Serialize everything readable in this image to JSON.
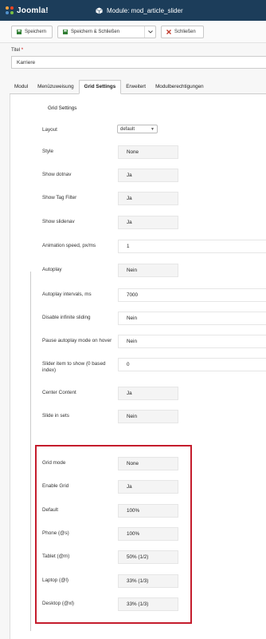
{
  "header": {
    "logo_text": "Joomla!",
    "module_title": "Module: mod_article_slider"
  },
  "toolbar": {
    "save_label": "Speichern",
    "save_close_label": "Speichern & Schließen",
    "close_label": "Schließen"
  },
  "title_field": {
    "label": "Titel",
    "required_mark": "*",
    "value": "Karriere"
  },
  "tabs": [
    {
      "label": "Modul"
    },
    {
      "label": "Menüzuweisung"
    },
    {
      "label": "Grid Settings",
      "active": true
    },
    {
      "label": "Erweitert"
    },
    {
      "label": "Modulberechtigungen"
    }
  ],
  "section_title": "Grid Settings",
  "settings": {
    "layout": {
      "label": "Layout",
      "value": "default"
    },
    "style": {
      "label": "Style",
      "value": "None"
    },
    "show_dotnav": {
      "label": "Show dotnav",
      "value": "Ja"
    },
    "show_tag_filter": {
      "label": "Show Tag Filter",
      "value": "Ja"
    },
    "show_slidenav": {
      "label": "Show slidenav",
      "value": "Ja"
    },
    "animation_speed": {
      "label": "Animation speed, px/ms",
      "value": "1"
    },
    "autoplay": {
      "label": "Autoplay",
      "value": "Nein"
    },
    "autoplay_interval": {
      "label": "Autoplay intervals, ms",
      "value": "7000"
    },
    "disable_infinite": {
      "label": "Disable infinite sliding",
      "value": "Nein"
    },
    "pause_autoplay": {
      "label": "Pause autoplay mode on hover",
      "value": "Nein"
    },
    "slider_item_show": {
      "label_line1": "Slider item to show (0 based",
      "label_line2": "index)",
      "value": "0"
    },
    "center_content": {
      "label": "Center Content",
      "value": "Ja"
    },
    "slide_in_sets": {
      "label": "Slide in sets",
      "value": "Nein"
    },
    "grid_mode": {
      "label": "Grid mode",
      "value": "None"
    },
    "enable_grid": {
      "label": "Enable Grid",
      "value": "Ja"
    },
    "default": {
      "label": "Default",
      "value": "100%"
    },
    "phone": {
      "label": "Phone (@s)",
      "value": "100%"
    },
    "tablet": {
      "label": "Tablet (@m)",
      "value": "50% (1/2)"
    },
    "laptop": {
      "label": "Laptop (@l)",
      "value": "33% (1/3)"
    },
    "desktop": {
      "label": "Desktop (@xl)",
      "value": "33% (1/3)"
    }
  },
  "colors": {
    "header_bg": "#1c3d5a",
    "save_icon": "#2f7d32",
    "close_icon": "#c0392b",
    "highlight_box": "#c41c2c"
  }
}
